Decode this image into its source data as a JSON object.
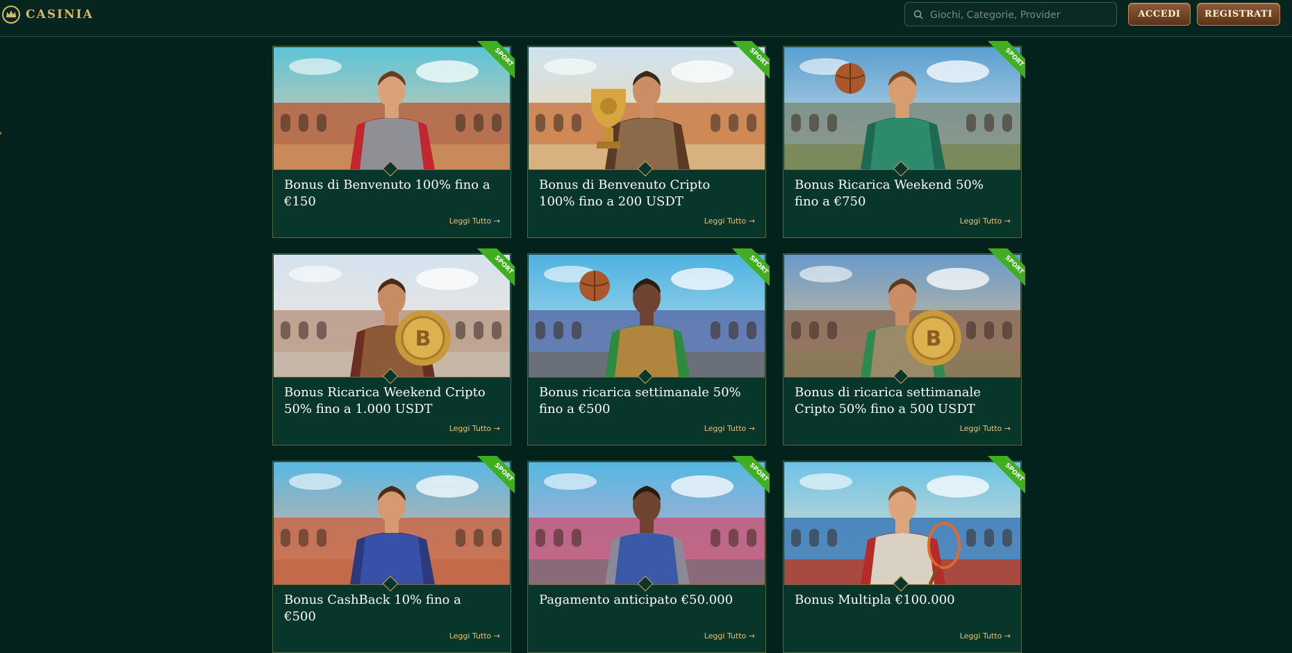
{
  "header": {
    "logo_text": "CASINIA",
    "search_placeholder": "Giochi, Categorie, Provider",
    "login_label": "ACCEDI",
    "register_label": "REGISTRATI"
  },
  "badge_label": "SPORT",
  "read_more_label": "Leggi Tutto →",
  "cards": [
    {
      "title": "Bonus di Benvenuto 100% fino a €150"
    },
    {
      "title": "Bonus di Benvenuto Cripto 100% fino a 200 USDT"
    },
    {
      "title": "Bonus Ricarica Weekend 50% fino a €750"
    },
    {
      "title": "Bonus Ricarica Weekend Cripto 50% fino a 1.000 USDT"
    },
    {
      "title": "Bonus ricarica settimanale 50% fino a €500"
    },
    {
      "title": "Bonus di ricarica settimanale Cripto 50% fino a 500 USDT"
    },
    {
      "title": "Bonus CashBack 10% fino a €500"
    },
    {
      "title": "Pagamento anticipato €50.000"
    },
    {
      "title": "Bonus Multipla €100.000"
    }
  ],
  "colors": {
    "background": "#04221c",
    "card": "#08362a",
    "accent_gold": "#d8b86a",
    "badge_green": "#3fae21",
    "button_brown": "#7a4a28"
  }
}
